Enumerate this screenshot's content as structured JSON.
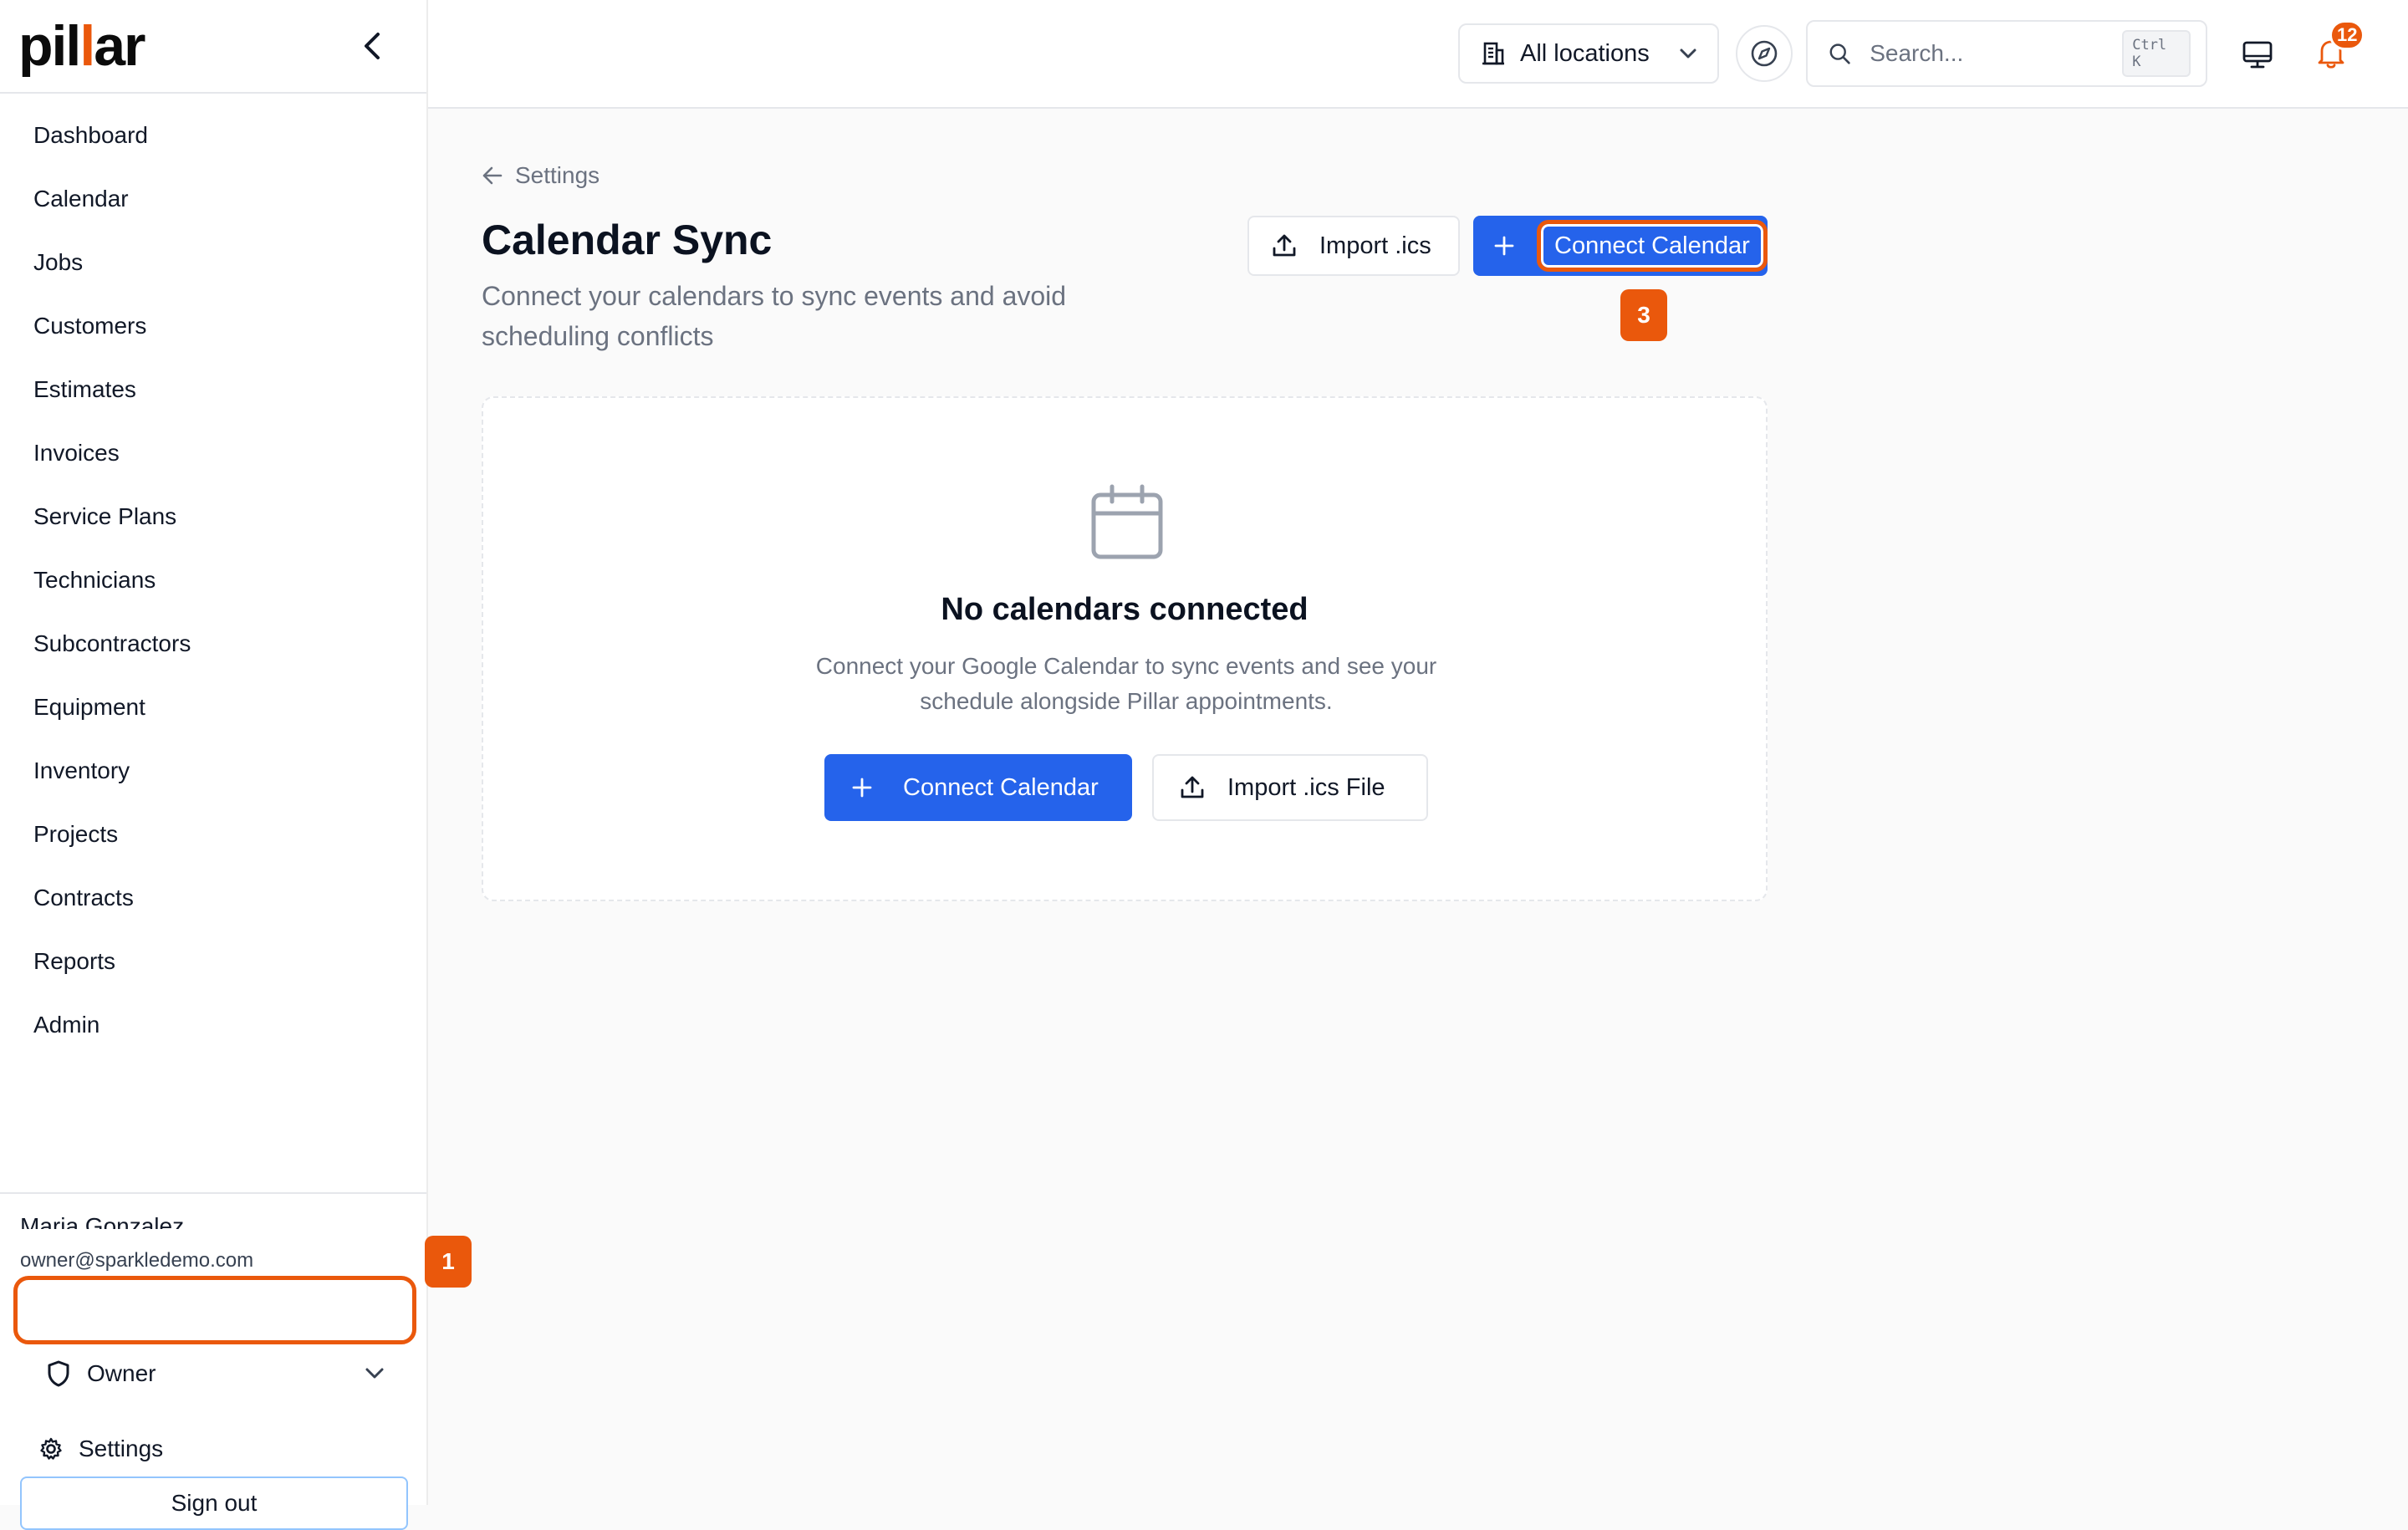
{
  "app": {
    "logo_main": "pil",
    "logo_accent": "l",
    "logo_end": "ar"
  },
  "sidebar": {
    "items": [
      {
        "label": "Dashboard"
      },
      {
        "label": "Calendar"
      },
      {
        "label": "Jobs"
      },
      {
        "label": "Customers"
      },
      {
        "label": "Estimates"
      },
      {
        "label": "Invoices"
      },
      {
        "label": "Service Plans"
      },
      {
        "label": "Technicians"
      },
      {
        "label": "Subcontractors"
      },
      {
        "label": "Equipment"
      },
      {
        "label": "Inventory"
      },
      {
        "label": "Projects"
      },
      {
        "label": "Contracts"
      },
      {
        "label": "Reports"
      },
      {
        "label": "Admin"
      }
    ],
    "user": {
      "name": "Maria Gonzalez",
      "email": "owner@sparkledemo.com",
      "role": "Owner"
    },
    "settings_label": "Settings",
    "signout_label": "Sign out"
  },
  "topbar": {
    "location": "All locations",
    "search_placeholder": "Search...",
    "shortcut": "Ctrl K",
    "notification_count": "12"
  },
  "main": {
    "back_label": "Settings",
    "title": "Calendar Sync",
    "subtitle": "Connect your calendars to sync events and avoid scheduling conflicts",
    "import_label": "Import .ics",
    "connect_label": "Connect Calendar",
    "empty": {
      "title": "No calendars connected",
      "description": "Connect your Google Calendar to sync events and see your schedule alongside Pillar appointments.",
      "connect_label": "Connect Calendar",
      "import_label": "Import .ics File"
    }
  },
  "annotations": {
    "badge_1": "1",
    "badge_3": "3"
  },
  "colors": {
    "accent": "#ea580c",
    "primary": "#2563eb"
  }
}
